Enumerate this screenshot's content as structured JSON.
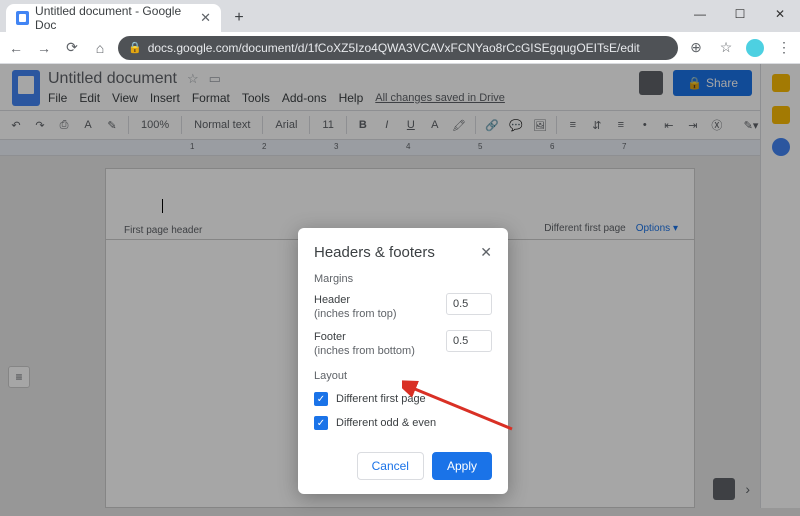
{
  "window": {
    "minimize": "—",
    "maximize": "☐",
    "close": "✕"
  },
  "tab": {
    "title": "Untitled document - Google Doc",
    "close": "✕",
    "newtab": "+"
  },
  "url": "docs.google.com/document/d/1fCoXZ5Izo4QWA3VCAVxFCNYao8rCcGISEgqugOEITsE/edit",
  "docs": {
    "title": "Untitled document",
    "menus": [
      "File",
      "Edit",
      "View",
      "Insert",
      "Format",
      "Tools",
      "Add-ons",
      "Help"
    ],
    "saved": "All changes saved in Drive",
    "share": "Share",
    "zoom": "100%",
    "style": "Normal text",
    "font": "Arial",
    "size": "11"
  },
  "page": {
    "header_label": "First page header",
    "diff_first": "Different first page",
    "options": "Options"
  },
  "modal": {
    "title": "Headers & footers",
    "section_margins": "Margins",
    "header_label": "Header",
    "header_sub": "(inches from top)",
    "header_val": "0.5",
    "footer_label": "Footer",
    "footer_sub": "(inches from bottom)",
    "footer_val": "0.5",
    "section_layout": "Layout",
    "chk_first": "Different first page",
    "chk_odd": "Different odd & even",
    "cancel": "Cancel",
    "apply": "Apply"
  }
}
